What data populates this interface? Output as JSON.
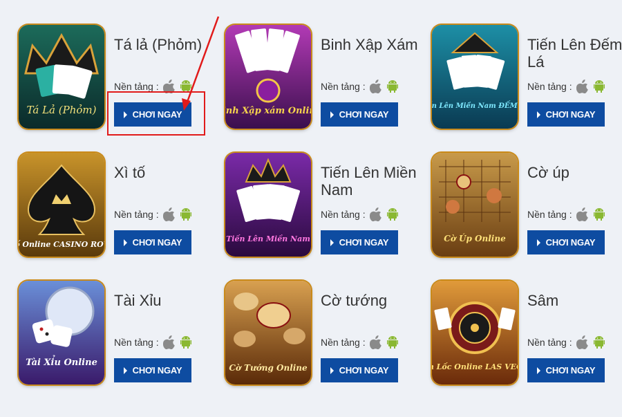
{
  "platform_label": "Nền tảng :",
  "play_label": "CHƠI NGAY",
  "games": [
    {
      "title": "Tá lả (Phỏm)",
      "logo_text": "Tá Lả (Phỏm)"
    },
    {
      "title": "Binh Xập Xám",
      "logo_text": "Binh Xập xám Online"
    },
    {
      "title": "Tiến Lên Đếm Lá",
      "logo_text": "Tiến Lên Miền Nam ĐẾM LÁ"
    },
    {
      "title": "Xì tố",
      "logo_text": "Xì Tố Online CASINO ROYALE"
    },
    {
      "title": "Tiến Lên Miền Nam",
      "logo_text": "Tiến Lên Miền Nam"
    },
    {
      "title": "Cờ úp",
      "logo_text": "Cờ Úp Online"
    },
    {
      "title": "Tài Xỉu",
      "logo_text": "Tài Xỉu Online"
    },
    {
      "title": "Cờ tướng",
      "logo_text": "Cờ Tướng Online"
    },
    {
      "title": "Sâm",
      "logo_text": "Sâm Lốc Online LAS VEGAS"
    }
  ],
  "colors": {
    "button": "#0e4ca1",
    "highlight": "#e11a1a",
    "background": "#eef1f6"
  }
}
